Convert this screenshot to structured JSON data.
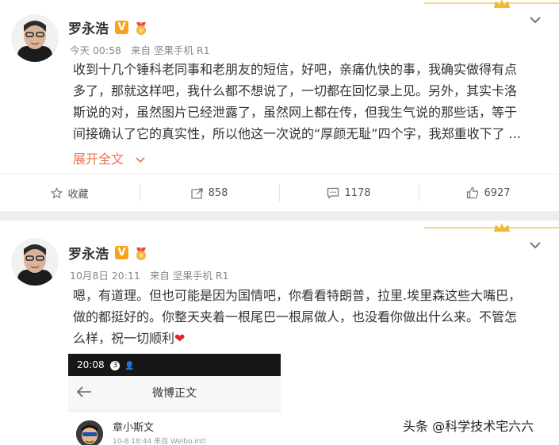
{
  "colors": {
    "accent": "#eb7350",
    "verified": "#f7a21b",
    "heart": "#e0242f",
    "gap": "#eceded"
  },
  "posts": [
    {
      "author": "罗永浩",
      "verified_badge": "V",
      "time": "今天 00:58",
      "source": "来自 坚果手机 R1",
      "text_lines": [
        "收到十几个锤科老同事和老朋友的短信，好吧，亲痛仇快的事，我确实做得有点",
        "多了，那就这样吧，我什么都不想说了，一切都在回忆录上见。另外，其实卡洛",
        "斯说的对，虽然图片已经泄露了，虽然网上都在传，但我生气说的那些话，等于",
        "间接确认了它的真实性，所以他这一次说的“厚颜无耻”四个字，我郑重收下了 ..."
      ],
      "expand_label": "展开全文",
      "actions": {
        "favorite": "收藏",
        "repost": "858",
        "comment": "1178",
        "like": "6927"
      }
    },
    {
      "author": "罗永浩",
      "verified_badge": "V",
      "time": "10月8日 20:11",
      "source": "来自 坚果手机 R1",
      "text_lines": [
        "嗯，有道理。但也可能是因为国情吧，你看看特朗普，拉里.埃里森这些大嘴巴，",
        "做的都挺好的。你整天夹着一根尾巴一根屌做人，也没看你做出什么来。不管怎",
        "么样，祝一切顺利"
      ],
      "heart": "❤",
      "screenshot": {
        "status_time": "20:08",
        "status_badge": "3",
        "nav_title": "微博正文",
        "card_name": "章小斯文",
        "card_meta": "10-8 18:44  来自 Weibo.intl"
      }
    }
  ],
  "watermark": "头条 @科学技术宅六六"
}
